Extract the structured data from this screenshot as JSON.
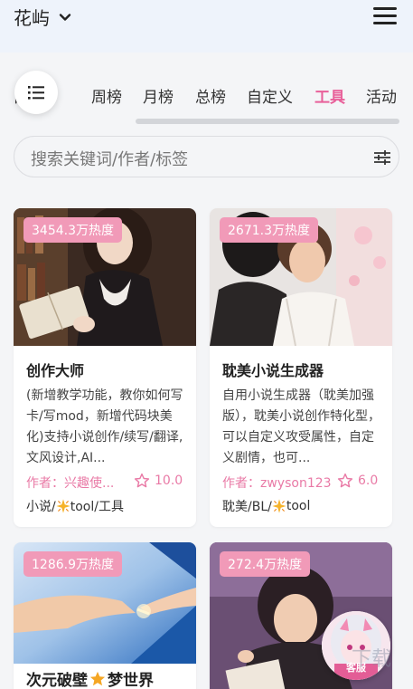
{
  "header": {
    "brand": "花屿"
  },
  "tabs": [
    "日榜",
    "周榜",
    "月榜",
    "总榜",
    "自定义",
    "工具",
    "活动"
  ],
  "active_tab": "工具",
  "search": {
    "placeholder": "搜索关键词/作者/标签"
  },
  "colors": {
    "accent": "#e8609a",
    "heat_badge": "#f19ab8"
  },
  "cards": [
    {
      "heat": "3454.3万热度",
      "title": "创作大师",
      "desc": "(新增教学功能，教你如何写卡/写mod，新增代码块美化)支持小说创作/续写/翻译,文风设计,AI...",
      "author": "作者：兴趣使...",
      "rating": "10.0",
      "tags_prefix": "小说/",
      "tags_suffix": "tool/工具"
    },
    {
      "heat": "2671.3万热度",
      "title": "耽美小说生成器",
      "desc": "自用小说生成器（耽美加强版），耽美小说创作特化型，可以自定义攻受属性，自定义剧情，也可...",
      "author": "作者：zwyson123",
      "rating": "6.0",
      "tags_prefix": "耽美/BL/",
      "tags_suffix": "tool"
    },
    {
      "heat": "1286.9万热度",
      "title_prefix": "次元破壁",
      "title_suffix": "梦世界"
    },
    {
      "heat": "272.4万热度"
    }
  ],
  "service": {
    "label": "客服"
  },
  "watermark": "下载"
}
